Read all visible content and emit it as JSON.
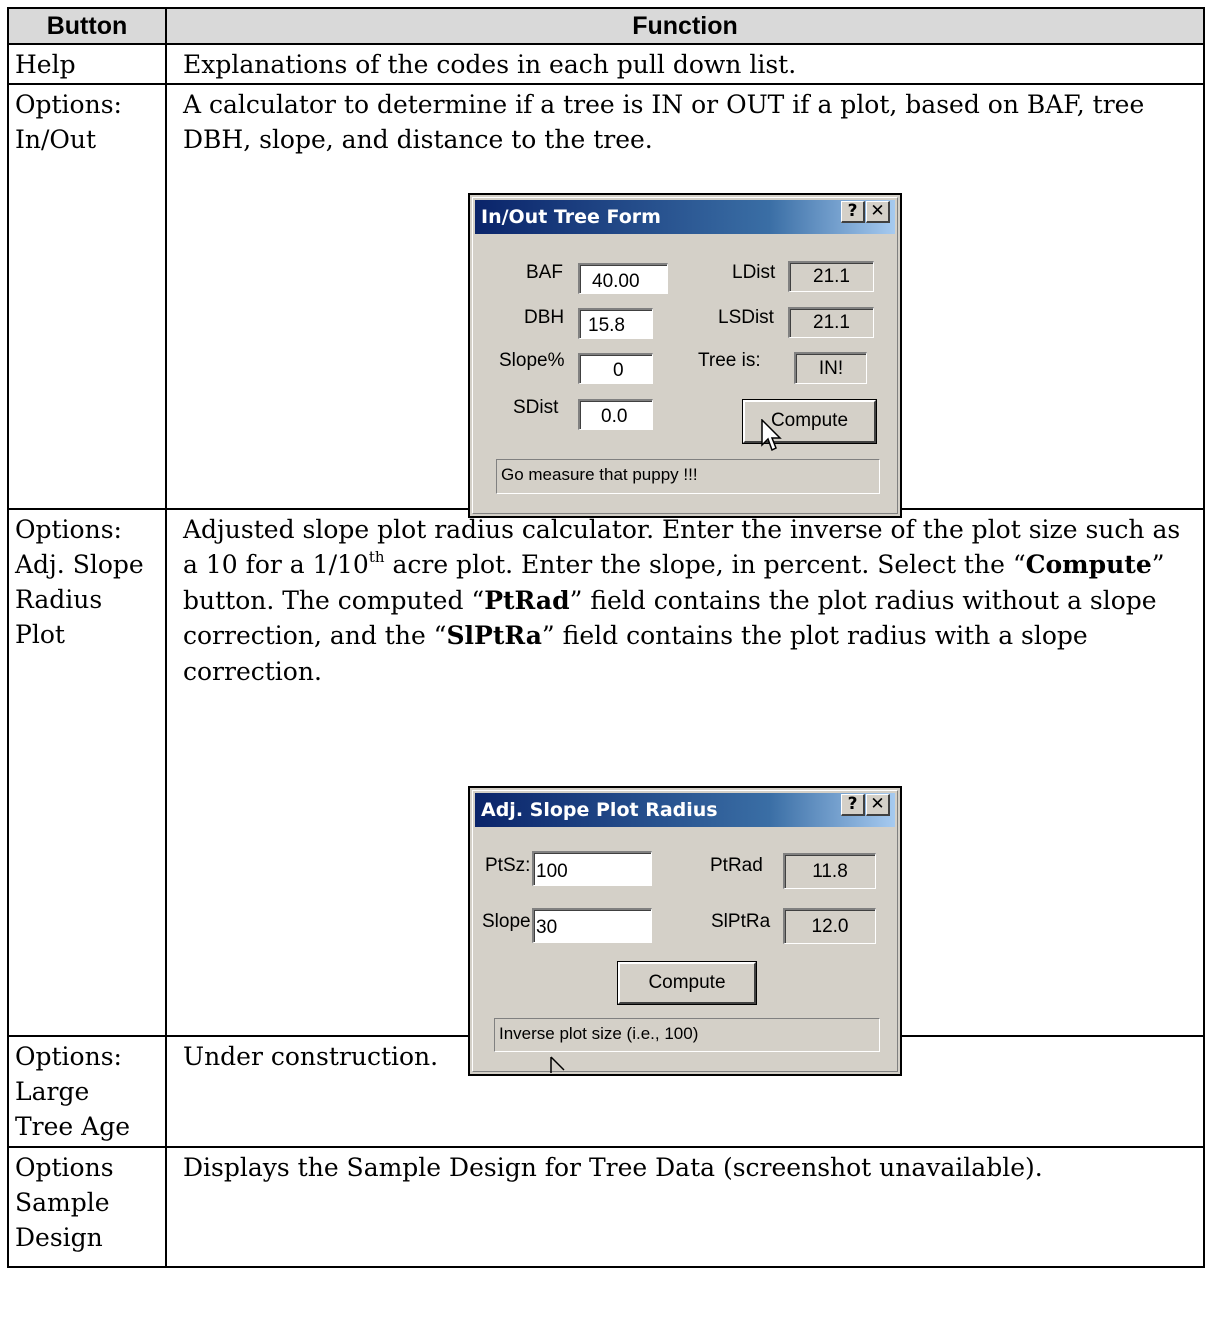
{
  "table": {
    "headers": {
      "button": "Button",
      "function": "Function"
    },
    "rows": [
      {
        "button": [
          "Help"
        ],
        "function": "Explanations of the codes in each pull down list."
      },
      {
        "button": [
          "Options:",
          "In/Out"
        ],
        "function": "A calculator to determine if a tree is IN or OUT if a plot, based on BAF, tree DBH, slope, and distance to the tree."
      },
      {
        "button": [
          "Options:",
          "Adj. Slope",
          "Radius",
          "Plot"
        ],
        "function_parts": {
          "p1": "Adjusted slope plot radius calculator.  Enter the inverse of the plot size such as a 10 for a 1/10",
          "sup": "th",
          "p2": " acre plot.  Enter the slope, in percent.  Select the “",
          "b1": "Compute",
          "p3": "” button.  The computed “",
          "b2": "PtRad",
          "p4": "” field contains the plot radius without a slope correction, and the “",
          "b3": "SlPtRa",
          "p5": "” field contains the plot radius with a slope correction."
        }
      },
      {
        "button": [
          "Options:",
          "Large",
          "Tree Age"
        ],
        "function": "Under construction."
      },
      {
        "button": [
          "Options",
          "Sample",
          "Design"
        ],
        "function": "Displays the Sample Design for Tree Data (screenshot unavailable)."
      }
    ]
  },
  "inout_dialog": {
    "title": "In/Out Tree Form",
    "help_btn": "?",
    "close_btn": "✕",
    "baf_label": "BAF",
    "baf_value": "40.00",
    "dbh_label": "DBH",
    "dbh_value": "15.8",
    "slope_label": "Slope%",
    "slope_value": "0",
    "sdist_label": "SDist",
    "sdist_value": "0.0",
    "ldist_label": "LDist",
    "ldist_value": "21.1",
    "lsdist_label": "LSDist",
    "lsdist_value": "21.1",
    "treeis_label": "Tree is:",
    "treeis_value": "IN!",
    "compute": "Compute",
    "status": "Go measure that puppy !!!"
  },
  "slope_dialog": {
    "title": "Adj. Slope Plot Radius",
    "help_btn": "?",
    "close_btn": "✕",
    "ptsz_label": "PtSz:",
    "ptsz_value": "100",
    "slope_label": "Slope:",
    "slope_value": "30",
    "ptrad_label": "PtRad",
    "ptrad_value": "11.8",
    "slptra_label": "SlPtRa",
    "slptra_value": "12.0",
    "compute": "Compute",
    "status": "Inverse plot size (i.e., 100)"
  }
}
